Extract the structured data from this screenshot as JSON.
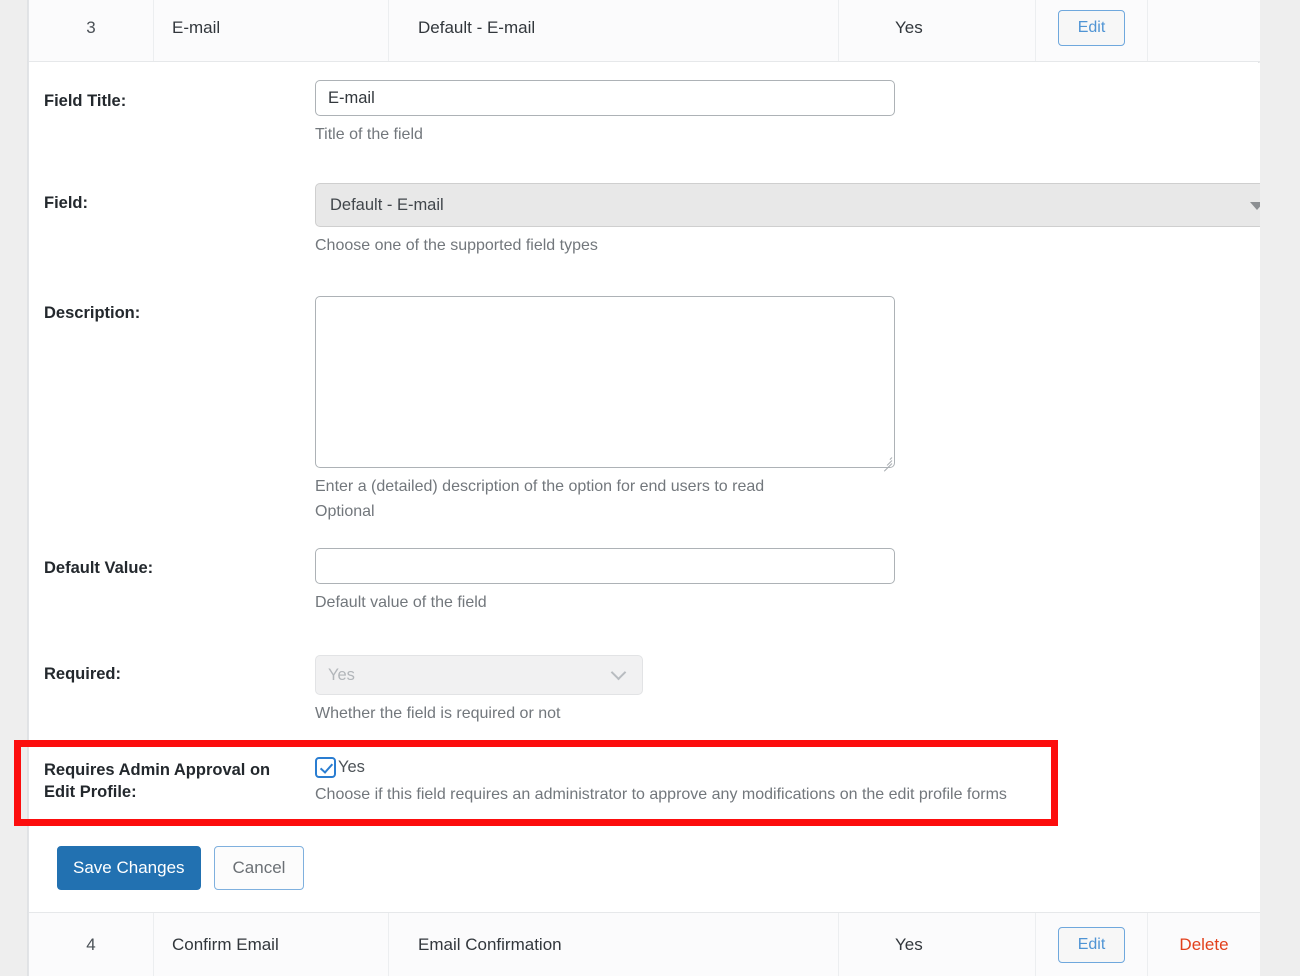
{
  "table": {
    "rows": [
      {
        "id": "3",
        "field_title": "E-mail",
        "field_type": "Default - E-mail",
        "required": "Yes",
        "edit_label": "Edit",
        "delete_label": ""
      },
      {
        "id": "4",
        "field_title": "Confirm Email",
        "field_type": "Email Confirmation",
        "required": "Yes",
        "edit_label": "Edit",
        "delete_label": "Delete"
      }
    ]
  },
  "form": {
    "field_title": {
      "label": "Field Title:",
      "value": "E-mail",
      "help": "Title of the field"
    },
    "field": {
      "label": "Field:",
      "value": "Default - E-mail",
      "help": "Choose one of the supported field types"
    },
    "description": {
      "label": "Description:",
      "value": "",
      "help_line1": "Enter a (detailed) description of the option for end users to read",
      "help_line2": "Optional"
    },
    "default_value": {
      "label": "Default Value:",
      "value": "",
      "help": "Default value of the field"
    },
    "required": {
      "label": "Required:",
      "value": "Yes",
      "help": "Whether the field is required or not"
    },
    "admin_approval": {
      "label": "Requires Admin Approval on Edit Profile:",
      "checkbox_label": "Yes",
      "checked": true,
      "help": "Choose if this field requires an administrator to approve any modifications on the edit profile forms"
    },
    "buttons": {
      "save": "Save Changes",
      "cancel": "Cancel"
    }
  },
  "colors": {
    "primary": "#2271b1",
    "link_blue": "#4f94d4",
    "delete_red": "#e2401c",
    "highlight_red": "#fc0d0d",
    "checkbox_blue": "#2a7dd1"
  }
}
